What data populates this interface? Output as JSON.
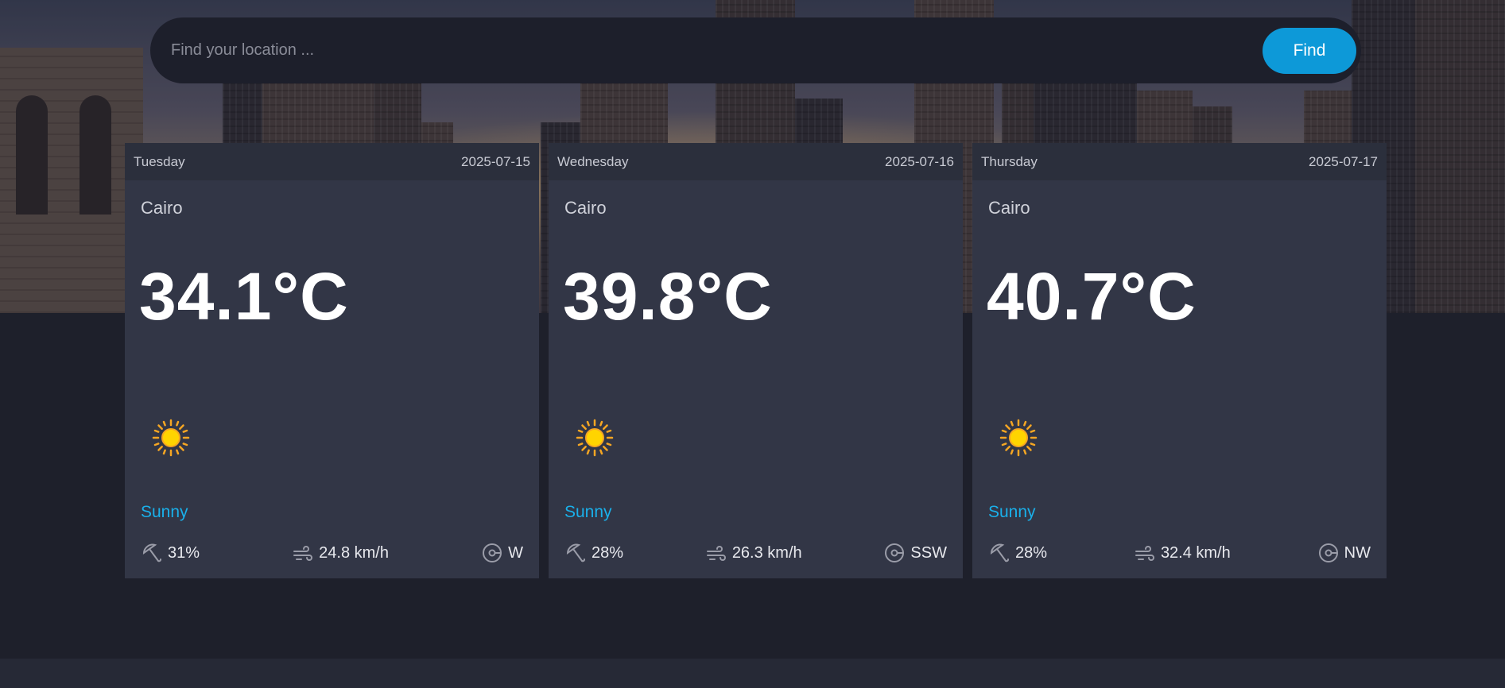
{
  "search": {
    "placeholder": "Find your location ...",
    "button_label": "Find"
  },
  "colors": {
    "accent": "#0d99d8",
    "condition_text": "#1ab0ea",
    "card_bg": "#323646",
    "card_header_bg": "#2b2f3c",
    "page_bg": "#1e202b"
  },
  "forecast": [
    {
      "day": "Tuesday",
      "date": "2025-07-15",
      "city": "Cairo",
      "temp": "34.1°C",
      "condition_icon": "sun-icon",
      "condition": "Sunny",
      "humidity": "31%",
      "wind_speed": "24.8 km/h",
      "wind_dir": "W"
    },
    {
      "day": "Wednesday",
      "date": "2025-07-16",
      "city": "Cairo",
      "temp": "39.8°C",
      "condition_icon": "sun-icon",
      "condition": "Sunny",
      "humidity": "28%",
      "wind_speed": "26.3 km/h",
      "wind_dir": "SSW"
    },
    {
      "day": "Thursday",
      "date": "2025-07-17",
      "city": "Cairo",
      "temp": "40.7°C",
      "condition_icon": "sun-icon",
      "condition": "Sunny",
      "humidity": "28%",
      "wind_speed": "32.4 km/h",
      "wind_dir": "NW"
    }
  ]
}
